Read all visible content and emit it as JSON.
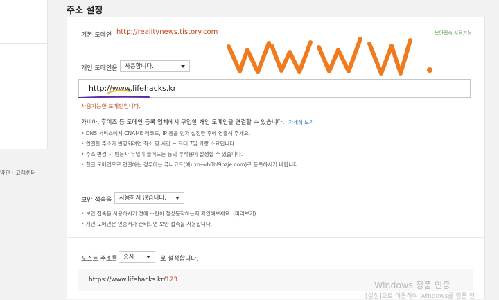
{
  "sidebar": {
    "footer": "약관 · 고객센터"
  },
  "page": {
    "title": "주소 설정"
  },
  "basic_domain": {
    "label": "기본 도메인",
    "value": "http://realitynews.tistory.com",
    "note": "보안접속 사용가능"
  },
  "personal_domain": {
    "label": "개인 도메인을",
    "select_value": "사용합니다.",
    "input_value": "http://www.lifehacks.kr",
    "status": "사용가능한 도메인입니다.",
    "info": "가비아, 후이즈 등 도메인 등록 업체에서 구입한 개인 도메인을 연결할 수 있습니다.",
    "info_link": "자세히 보기",
    "bullets": [
      "DNS 서비스에서 CNAME 레코드, IP 등을 먼저 설정한 후에 연결해 주세요.",
      "연결한 주소가 반영되려면 최소 몇 시간 ~ 최대 7일 가량 소요됩니다.",
      "주소 변경 시 방문자 유입이 줄어드는 등의 부작용이 발생할 수 있습니다.",
      "한글 도메인으로 연결하는 경우에는 퓨니코드(예) xn--vb0bl9bzje.com)로 등록하시기 바랍니다."
    ]
  },
  "secure_access": {
    "label": "보안 접속을",
    "select_value": "사용하지 않습니다.",
    "bullets": [
      "보안 접속을 사용하시기 전에 스킨이 정상동작하는지 확인해보세요. (미리보기)",
      "개인 도메인은 인증서가 준비되면 보안 접속을 사용합니다."
    ]
  },
  "post_address": {
    "label": "포스트 주소를",
    "select_value": "숫자",
    "suffix": "로 설정합니다.",
    "example_base": "https://www.lifehacks.kr/",
    "example_num": "123"
  },
  "annotation": {
    "handwriting": "www."
  },
  "watermark": {
    "line1": "Windows 정품 인증",
    "line2": "[설정]으로 이동하여 Windows를 정품 인"
  },
  "colors": {
    "accent": "#c4491f",
    "handwriting": "#f07a1e",
    "underline_yellow": "#f2b21a",
    "underline_purple": "#5b2ca8"
  }
}
